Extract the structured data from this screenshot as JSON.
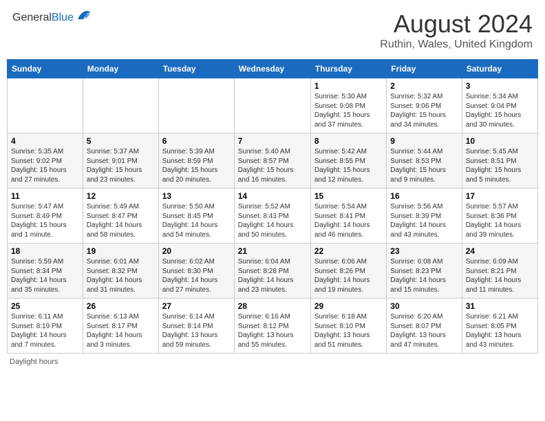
{
  "header": {
    "logo_general": "General",
    "logo_blue": "Blue",
    "month_title": "August 2024",
    "location": "Ruthin, Wales, United Kingdom"
  },
  "days_of_week": [
    "Sunday",
    "Monday",
    "Tuesday",
    "Wednesday",
    "Thursday",
    "Friday",
    "Saturday"
  ],
  "footer": {
    "daylight_label": "Daylight hours"
  },
  "weeks": [
    [
      {
        "day": "",
        "info": ""
      },
      {
        "day": "",
        "info": ""
      },
      {
        "day": "",
        "info": ""
      },
      {
        "day": "",
        "info": ""
      },
      {
        "day": "1",
        "info": "Sunrise: 5:30 AM\nSunset: 9:08 PM\nDaylight: 15 hours\nand 37 minutes."
      },
      {
        "day": "2",
        "info": "Sunrise: 5:32 AM\nSunset: 9:06 PM\nDaylight: 15 hours\nand 34 minutes."
      },
      {
        "day": "3",
        "info": "Sunrise: 5:34 AM\nSunset: 9:04 PM\nDaylight: 15 hours\nand 30 minutes."
      }
    ],
    [
      {
        "day": "4",
        "info": "Sunrise: 5:35 AM\nSunset: 9:02 PM\nDaylight: 15 hours\nand 27 minutes."
      },
      {
        "day": "5",
        "info": "Sunrise: 5:37 AM\nSunset: 9:01 PM\nDaylight: 15 hours\nand 23 minutes."
      },
      {
        "day": "6",
        "info": "Sunrise: 5:39 AM\nSunset: 8:59 PM\nDaylight: 15 hours\nand 20 minutes."
      },
      {
        "day": "7",
        "info": "Sunrise: 5:40 AM\nSunset: 8:57 PM\nDaylight: 15 hours\nand 16 minutes."
      },
      {
        "day": "8",
        "info": "Sunrise: 5:42 AM\nSunset: 8:55 PM\nDaylight: 15 hours\nand 12 minutes."
      },
      {
        "day": "9",
        "info": "Sunrise: 5:44 AM\nSunset: 8:53 PM\nDaylight: 15 hours\nand 9 minutes."
      },
      {
        "day": "10",
        "info": "Sunrise: 5:45 AM\nSunset: 8:51 PM\nDaylight: 15 hours\nand 5 minutes."
      }
    ],
    [
      {
        "day": "11",
        "info": "Sunrise: 5:47 AM\nSunset: 8:49 PM\nDaylight: 15 hours\nand 1 minute."
      },
      {
        "day": "12",
        "info": "Sunrise: 5:49 AM\nSunset: 8:47 PM\nDaylight: 14 hours\nand 58 minutes."
      },
      {
        "day": "13",
        "info": "Sunrise: 5:50 AM\nSunset: 8:45 PM\nDaylight: 14 hours\nand 54 minutes."
      },
      {
        "day": "14",
        "info": "Sunrise: 5:52 AM\nSunset: 8:43 PM\nDaylight: 14 hours\nand 50 minutes."
      },
      {
        "day": "15",
        "info": "Sunrise: 5:54 AM\nSunset: 8:41 PM\nDaylight: 14 hours\nand 46 minutes."
      },
      {
        "day": "16",
        "info": "Sunrise: 5:56 AM\nSunset: 8:39 PM\nDaylight: 14 hours\nand 43 minutes."
      },
      {
        "day": "17",
        "info": "Sunrise: 5:57 AM\nSunset: 8:36 PM\nDaylight: 14 hours\nand 39 minutes."
      }
    ],
    [
      {
        "day": "18",
        "info": "Sunrise: 5:59 AM\nSunset: 8:34 PM\nDaylight: 14 hours\nand 35 minutes."
      },
      {
        "day": "19",
        "info": "Sunrise: 6:01 AM\nSunset: 8:32 PM\nDaylight: 14 hours\nand 31 minutes."
      },
      {
        "day": "20",
        "info": "Sunrise: 6:02 AM\nSunset: 8:30 PM\nDaylight: 14 hours\nand 27 minutes."
      },
      {
        "day": "21",
        "info": "Sunrise: 6:04 AM\nSunset: 8:28 PM\nDaylight: 14 hours\nand 23 minutes."
      },
      {
        "day": "22",
        "info": "Sunrise: 6:06 AM\nSunset: 8:26 PM\nDaylight: 14 hours\nand 19 minutes."
      },
      {
        "day": "23",
        "info": "Sunrise: 6:08 AM\nSunset: 8:23 PM\nDaylight: 14 hours\nand 15 minutes."
      },
      {
        "day": "24",
        "info": "Sunrise: 6:09 AM\nSunset: 8:21 PM\nDaylight: 14 hours\nand 11 minutes."
      }
    ],
    [
      {
        "day": "25",
        "info": "Sunrise: 6:11 AM\nSunset: 8:19 PM\nDaylight: 14 hours\nand 7 minutes."
      },
      {
        "day": "26",
        "info": "Sunrise: 6:13 AM\nSunset: 8:17 PM\nDaylight: 14 hours\nand 3 minutes."
      },
      {
        "day": "27",
        "info": "Sunrise: 6:14 AM\nSunset: 8:14 PM\nDaylight: 13 hours\nand 59 minutes."
      },
      {
        "day": "28",
        "info": "Sunrise: 6:16 AM\nSunset: 8:12 PM\nDaylight: 13 hours\nand 55 minutes."
      },
      {
        "day": "29",
        "info": "Sunrise: 6:18 AM\nSunset: 8:10 PM\nDaylight: 13 hours\nand 51 minutes."
      },
      {
        "day": "30",
        "info": "Sunrise: 6:20 AM\nSunset: 8:07 PM\nDaylight: 13 hours\nand 47 minutes."
      },
      {
        "day": "31",
        "info": "Sunrise: 6:21 AM\nSunset: 8:05 PM\nDaylight: 13 hours\nand 43 minutes."
      }
    ]
  ]
}
